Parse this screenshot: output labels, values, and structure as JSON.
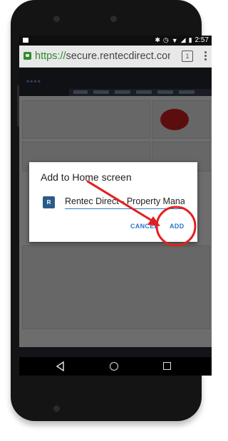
{
  "status_bar": {
    "time": "2:57",
    "icons": [
      "notification-icon",
      "bluetooth-icon",
      "alarm-icon",
      "wifi-icon",
      "signal-icon",
      "battery-icon"
    ]
  },
  "browser": {
    "url_scheme": "https://",
    "url_host": "secure.rentecdirect.com/o",
    "tab_count": "1"
  },
  "dialog": {
    "title": "Add to Home screen",
    "app_icon_letter": "R",
    "name_value": "Rentec Direct - Property Management",
    "cancel_label": "CANCEL",
    "add_label": "ADD"
  },
  "colors": {
    "accent": "#2979c9",
    "annotation": "#e02020",
    "secure_green": "#2e8b2e"
  }
}
